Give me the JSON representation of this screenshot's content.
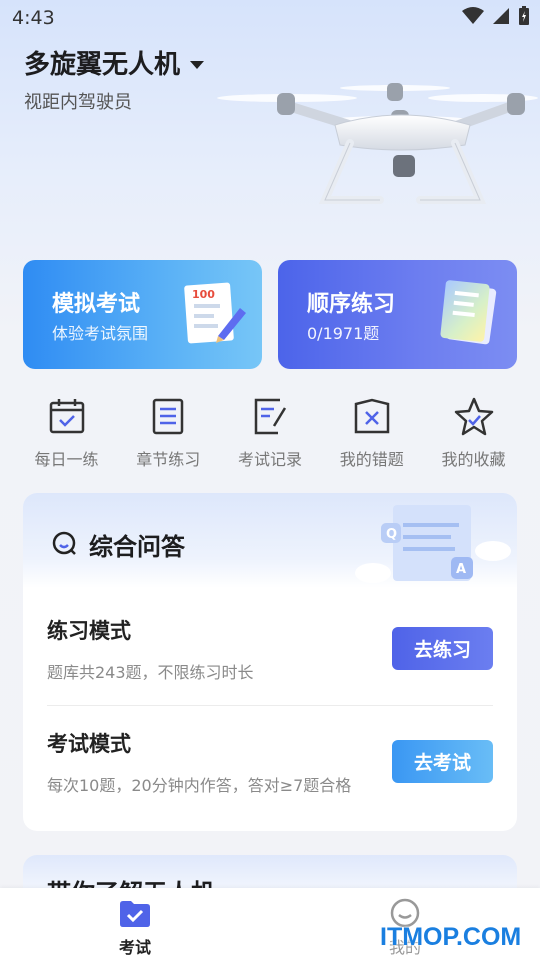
{
  "status": {
    "time": "4:43"
  },
  "header": {
    "title": "多旋翼无人机",
    "subtitle": "视距内驾驶员"
  },
  "cards": [
    {
      "title": "模拟考试",
      "subtitle": "体验考试氛围",
      "badge": "100"
    },
    {
      "title": "顺序练习",
      "subtitle": "0/1971题"
    }
  ],
  "quick": [
    {
      "label": "每日一练",
      "icon": "calendar-check-icon"
    },
    {
      "label": "章节练习",
      "icon": "list-icon"
    },
    {
      "label": "考试记录",
      "icon": "note-edit-icon"
    },
    {
      "label": "我的错题",
      "icon": "wrong-x-icon"
    },
    {
      "label": "我的收藏",
      "icon": "star-icon"
    }
  ],
  "panel": {
    "title": "综合问答",
    "art_q": "Q",
    "art_a": "A",
    "modes": [
      {
        "title": "练习模式",
        "desc": "题库共243题，不限练习时长",
        "button": "去练习"
      },
      {
        "title": "考试模式",
        "desc": "每次10题，20分钟内作答，答对≥7题合格",
        "button": "去考试"
      }
    ]
  },
  "peek": {
    "title": "带你了解无人机"
  },
  "tabs": [
    {
      "label": "考试",
      "icon": "exam-check-icon",
      "active": true
    },
    {
      "label": "我的",
      "icon": "profile-icon",
      "active": false
    }
  ],
  "watermark": "ITMOP.COM",
  "colors": {
    "accent": "#4f63e8",
    "blue": "#3a97f3"
  }
}
